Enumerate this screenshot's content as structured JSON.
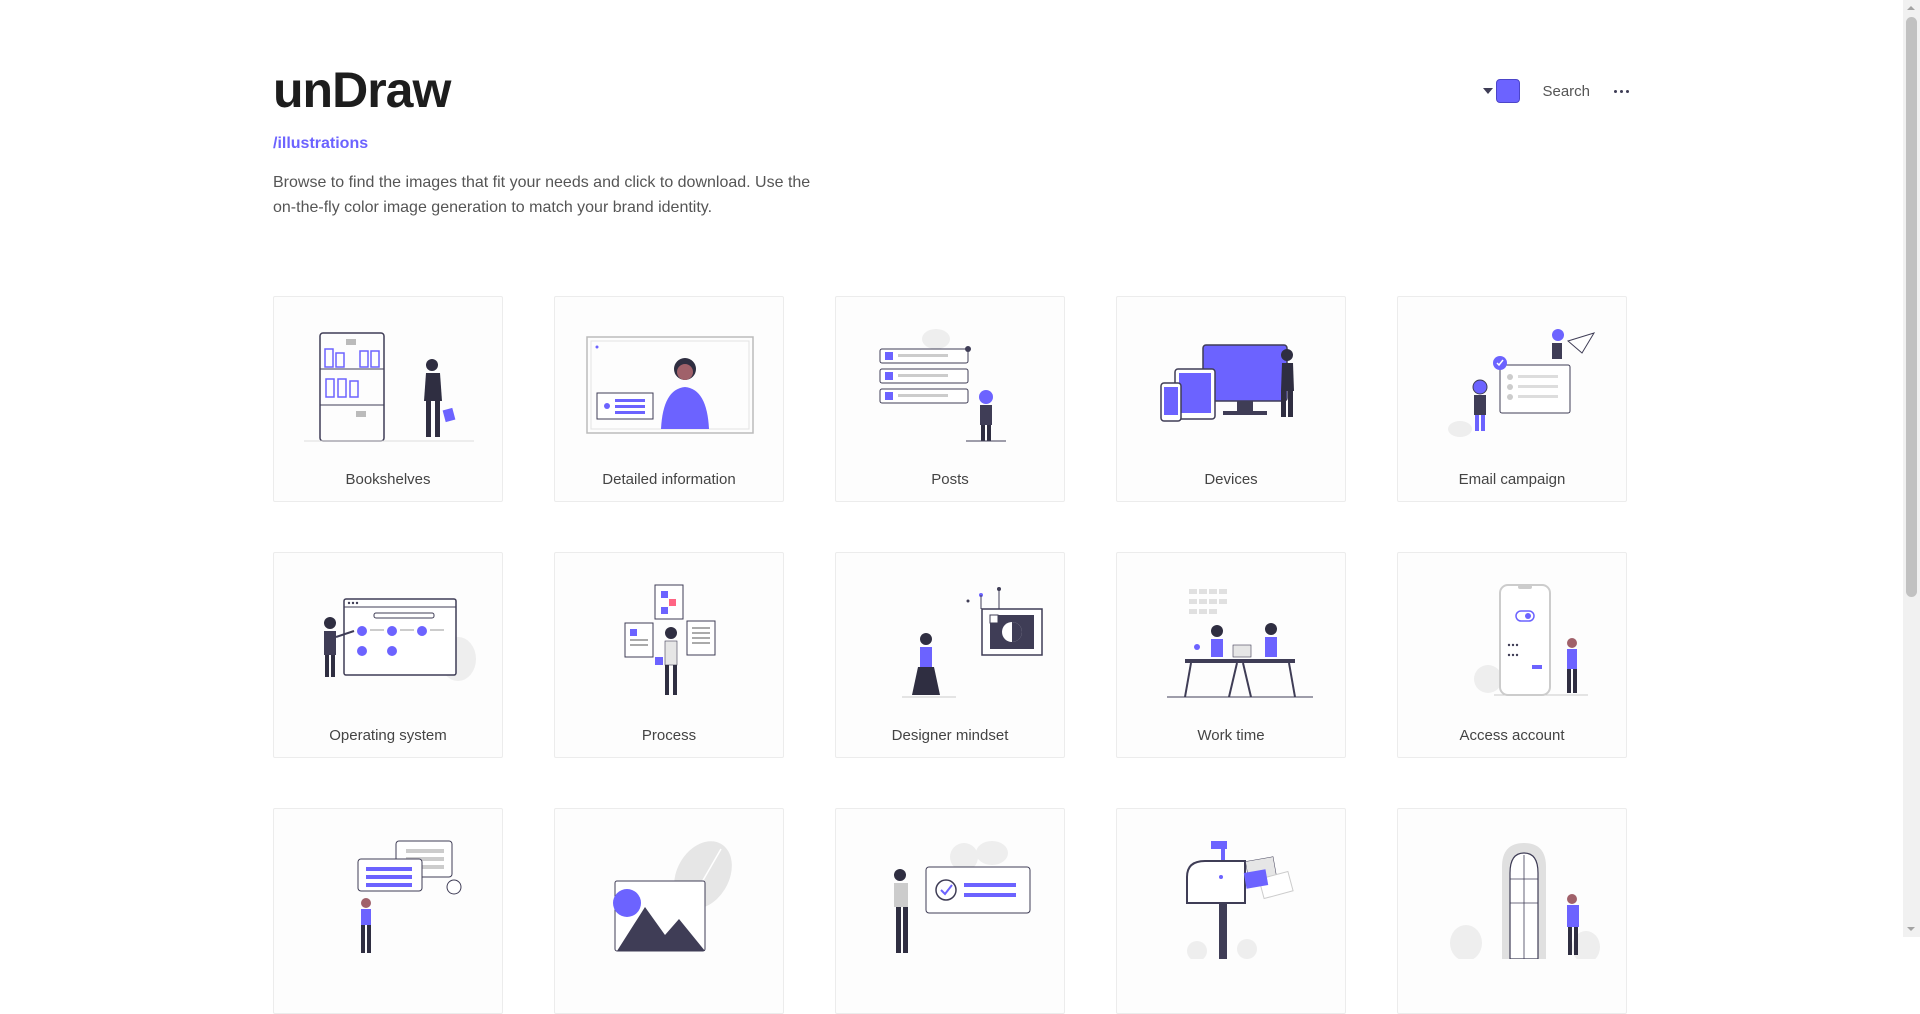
{
  "header": {
    "logo": "unDraw",
    "subtitle": "/illustrations",
    "description": "Browse to find the images that fit your needs and click to download. Use the on-the-fly color image generation to match your brand identity."
  },
  "nav": {
    "accent_color": "#6c63ff",
    "search_label": "Search",
    "more_icon": "ellipsis-icon"
  },
  "cards": [
    {
      "label": "Bookshelves"
    },
    {
      "label": "Detailed information"
    },
    {
      "label": "Posts"
    },
    {
      "label": "Devices"
    },
    {
      "label": "Email campaign"
    },
    {
      "label": "Operating system"
    },
    {
      "label": "Process"
    },
    {
      "label": "Designer mindset"
    },
    {
      "label": "Work time"
    },
    {
      "label": "Access account"
    },
    {
      "label": ""
    },
    {
      "label": ""
    },
    {
      "label": ""
    },
    {
      "label": ""
    },
    {
      "label": ""
    }
  ]
}
